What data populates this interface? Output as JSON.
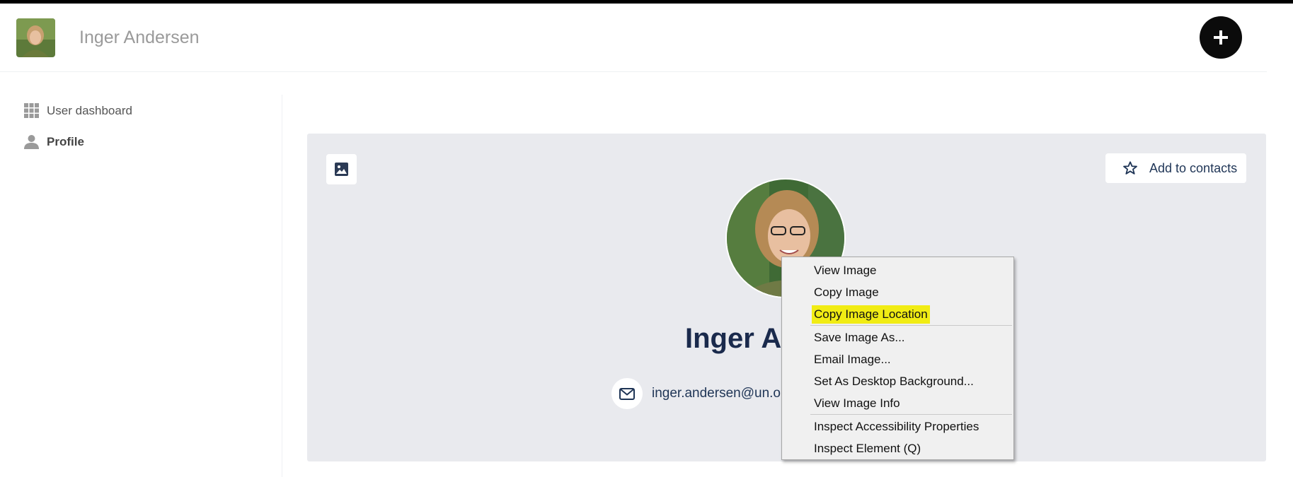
{
  "header": {
    "title": "Inger Andersen",
    "avatar_alt": "user-avatar",
    "fab_icon": "plus-icon"
  },
  "sidebar": {
    "items": [
      {
        "label": "User dashboard",
        "icon": "grid-icon",
        "active": false
      },
      {
        "label": "Profile",
        "icon": "user-icon",
        "active": true
      }
    ]
  },
  "profile": {
    "name": "Inger A",
    "email": "inger.andersen@un.o",
    "add_contacts_label": "Add to contacts",
    "cover_button_icon": "image-icon"
  },
  "context_menu": {
    "items": [
      {
        "label": "View Image"
      },
      {
        "label": "Copy Image"
      },
      {
        "label": "Copy Image Location",
        "highlighted": true
      },
      {
        "label": "Save Image As..."
      },
      {
        "label": "Email Image..."
      },
      {
        "label": "Set As Desktop Background..."
      },
      {
        "label": "View Image Info"
      },
      {
        "label": "Inspect Accessibility Properties"
      },
      {
        "label": "Inspect Element (Q)"
      }
    ],
    "highlight_color": "#f1ec14"
  },
  "colors": {
    "card_background": "#e9eaee",
    "name_color": "#1a2a4c",
    "fab_background": "#0b0b0b"
  }
}
